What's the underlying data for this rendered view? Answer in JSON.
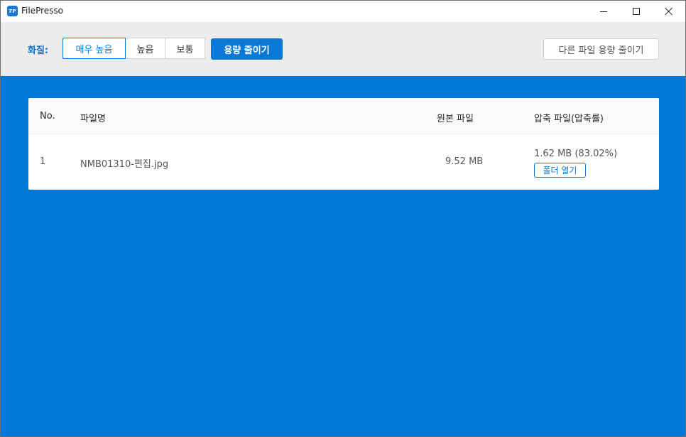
{
  "window": {
    "title": "FilePresso",
    "logo_text": "FP"
  },
  "toolbar": {
    "quality_label": "화질:",
    "quality_options": [
      "매우 높음",
      "높음",
      "보통"
    ],
    "selected_quality": "매우 높음",
    "compress_label": "용량 줄이기",
    "other_file_label": "다른 파일 용량 줄이기"
  },
  "table": {
    "columns": [
      "No.",
      "파일명",
      "원본 파일",
      "압축 파일(압축률)"
    ],
    "rows": [
      {
        "no": "1",
        "name": "NMB01310-편집.jpg",
        "original": "9.52 MB",
        "compressed": "1.62 MB (83.02%)",
        "open_folder_label": "폴더 열기"
      }
    ]
  },
  "colors": {
    "accent": "#0a78d4",
    "background": "#0078d7",
    "toolbar": "#ececec"
  }
}
